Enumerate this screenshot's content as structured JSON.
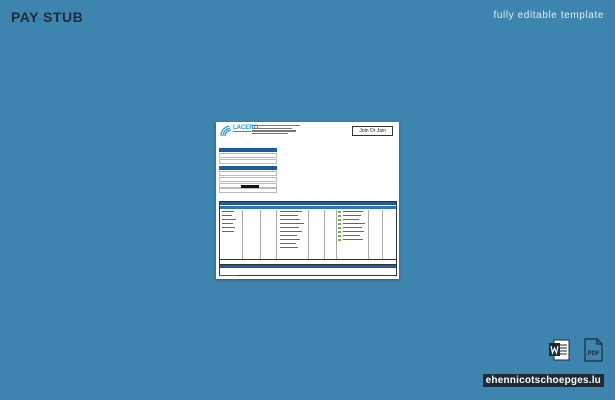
{
  "page": {
    "title": "PAY STUB",
    "subtitle": "fully editable template"
  },
  "document": {
    "logo_text": "LACERO",
    "join_button": "Join Or Join",
    "preview": "pay-stub-thumbnail"
  },
  "file_icons": [
    "word-icon",
    "pdf-icon"
  ],
  "pdf_label": "PDF",
  "brand": "ehennicotschoepges.lu",
  "colors": {
    "background": "#3d85ae",
    "header_bar": "#1f5b9a",
    "brand_bg": "#1e2a38"
  }
}
